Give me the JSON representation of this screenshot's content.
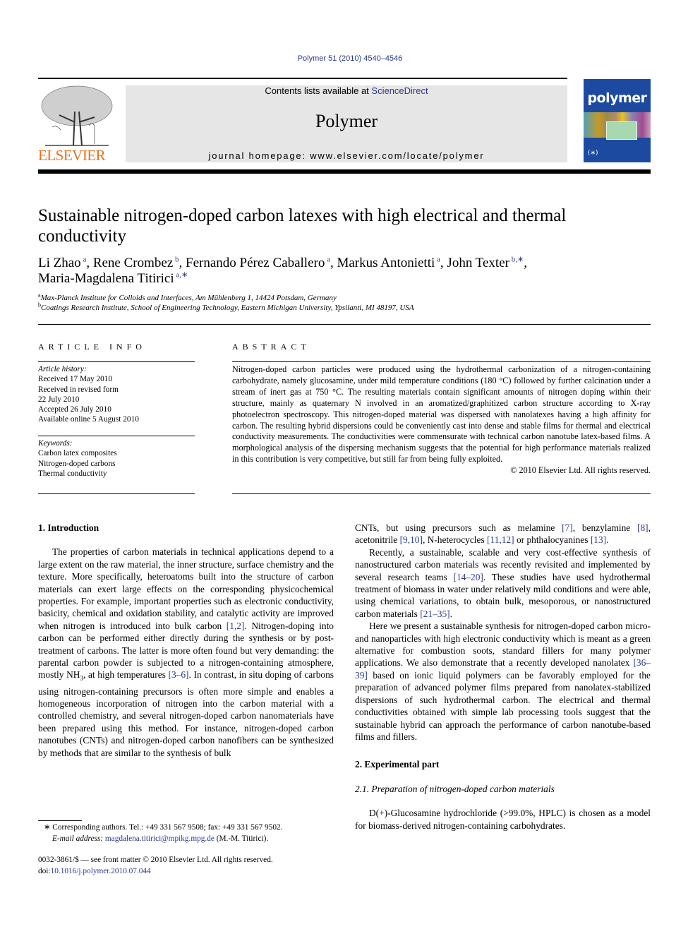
{
  "journal_ref": "Polymer 51 (2010) 4540–4546",
  "masthead": {
    "contents_prefix": "Contents lists available at ",
    "contents_link": "ScienceDirect",
    "journal_name": "Polymer",
    "homepage": "journal homepage: www.elsevier.com/locate/polymer"
  },
  "publisher_logo_text": "ELSEVIER",
  "cover": {
    "title": "polymer",
    "emblem": "(∗)"
  },
  "colors": {
    "link": "#2a3a8c",
    "elsevier_orange": "#e9711c",
    "masthead_bg": "#e6e6e6",
    "cover_blue": "#1d4aa1"
  },
  "article": {
    "title": "Sustainable nitrogen-doped carbon latexes with high electrical and thermal conductivity",
    "authors": [
      {
        "name": "Li Zhao",
        "aff": "a",
        "sep": ", "
      },
      {
        "name": "Rene Crombez",
        "aff": "b",
        "sep": ", "
      },
      {
        "name": "Fernando Pérez Caballero",
        "aff": "a",
        "sep": ", "
      },
      {
        "name": "Markus Antonietti",
        "aff": "a",
        "sep": ", "
      },
      {
        "name": "John Texter",
        "aff": "b,∗",
        "sep": ","
      },
      {
        "name": "Maria-Magdalena Titirici",
        "aff": "a,∗",
        "sep": ""
      }
    ],
    "affiliations": [
      {
        "key": "a",
        "text": "Max-Planck Institute for Colloids and Interfaces, Am Mühlenberg 1, 14424 Potsdam, Germany"
      },
      {
        "key": "b",
        "text": "Coatings Research Institute, School of Engineering Technology, Eastern Michigan University, Ypsilanti, MI 48197, USA"
      }
    ]
  },
  "article_info": {
    "heading": "ARTICLE INFO",
    "history_label": "Article history:",
    "history": [
      "Received 17 May 2010",
      "Received in revised form",
      "22 July 2010",
      "Accepted 26 July 2010",
      "Available online 5 August 2010"
    ],
    "keywords_label": "Keywords:",
    "keywords": [
      "Carbon latex composites",
      "Nitrogen-doped carbons",
      "Thermal conductivity"
    ]
  },
  "abstract": {
    "heading": "ABSTRACT",
    "text": "Nitrogen-doped carbon particles were produced using the hydrothermal carbonization of a nitrogen-containing carbohydrate, namely glucosamine, under mild temperature conditions (180 °C) followed by further calcination under a stream of inert gas at 750 °C. The resulting materials contain significant amounts of nitrogen doping within their structure, mainly as quaternary N involved in an aromatized/graphitized carbon structure according to X-ray photoelectron spectroscopy. This nitrogen-doped material was dispersed with nanolatexes having a high affinity for carbon. The resulting hybrid dispersions could be conveniently cast into dense and stable films for thermal and electrical conductivity measurements. The conductivities were commensurate with technical carbon nanotube latex-based films. A morphological analysis of the dispersing mechanism suggests that the potential for high performance materials realized in this contribution is very competitive, but still far from being fully exploited.",
    "copyright": "© 2010 Elsevier Ltd. All rights reserved."
  },
  "body": {
    "intro_heading": "1.  Introduction",
    "intro_p1": [
      {
        "t": "The properties of carbon materials in technical applications depend to a large extent on the raw material, the inner structure, surface chemistry and the texture. More specifically, heteroatoms built into the structure of carbon materials can exert large effects on the corresponding physicochemical properties. For example, important properties such as electronic conductivity, basicity, chemical and oxidation stability, and catalytic activity are improved when nitrogen is introduced into bulk carbon "
      },
      {
        "c": "[1,2]"
      },
      {
        "t": ". Nitrogen-doping into carbon can be performed either directly during the synthesis or by post-treatment of carbons. The latter is more often found but very demanding: the parental carbon powder is subjected to a nitrogen-containing atmosphere, mostly NH"
      },
      {
        "sub": "3"
      },
      {
        "t": ", at high temperatures "
      },
      {
        "c": "[3–6]"
      },
      {
        "t": ". In contrast, in situ doping of carbons using nitrogen-containing precursors is often more simple and enables a homogeneous incorporation of nitrogen into the carbon material with a controlled chemistry, and several nitrogen-doped carbon nanomaterials have been prepared using this method. For instance, nitrogen-doped carbon nanotubes (CNTs) and nitrogen-doped carbon nanofibers can be synthesized by methods that are similar to the synthesis of bulk CNTs, but using precursors such as melamine "
      },
      {
        "c": "[7]"
      },
      {
        "t": ", benzylamine "
      },
      {
        "c": "[8]"
      },
      {
        "t": ", acetonitrile "
      },
      {
        "c": "[9,10]"
      },
      {
        "t": ", N-heterocycles "
      },
      {
        "c": "[11,12]"
      },
      {
        "t": " or phthalocyanines "
      },
      {
        "c": "[13]"
      },
      {
        "t": "."
      }
    ],
    "intro_p2": [
      {
        "t": "Recently, a sustainable, scalable and very cost-effective synthesis of nanostructured carbon materials was recently revisited and implemented by several research teams "
      },
      {
        "c": "[14–20]"
      },
      {
        "t": ". These studies have used hydrothermal treatment of biomass in water under relatively mild conditions and were able, using chemical variations, to obtain bulk, mesoporous, or nanostructured carbon materials "
      },
      {
        "c": "[21–35]"
      },
      {
        "t": "."
      }
    ],
    "intro_p3": [
      {
        "t": "Here we present a sustainable synthesis for nitrogen-doped carbon micro- and nanoparticles with high electronic conductivity which is meant as a green alternative for combustion soots, standard fillers for many polymer applications. We also demonstrate that a recently developed nanolatex "
      },
      {
        "c": "[36–39]"
      },
      {
        "t": " based on ionic liquid polymers can be favorably employed for the preparation of advanced polymer films prepared from nanolatex-stabilized dispersions of such hydrothermal carbon. The electrical and thermal conductivities obtained with simple lab processing tools suggest that the sustainable hybrid can approach the performance of carbon nanotube-based films and fillers."
      }
    ],
    "exp_heading": "2.  Experimental part",
    "subsec_heading": "2.1.  Preparation of nitrogen-doped carbon materials",
    "exp_p1": "D(+)-Glucosamine hydrochloride (>99.0%, HPLC) is chosen as a model for biomass-derived nitrogen-containing carbohydrates."
  },
  "footnotes": {
    "corresponding": "∗  Corresponding authors. Tel.: +49 331 567 9508; fax: +49 331 567 9502.",
    "email_label": "E-mail address:",
    "email": "magdalena.titirici@mpikg.mpg.de",
    "email_suffix": " (M.-M. Titirici).",
    "front_matter": "0032-3861/$ — see front matter © 2010 Elsevier Ltd. All rights reserved.",
    "doi_prefix": "doi:",
    "doi": "10.1016/j.polymer.2010.07.044"
  }
}
